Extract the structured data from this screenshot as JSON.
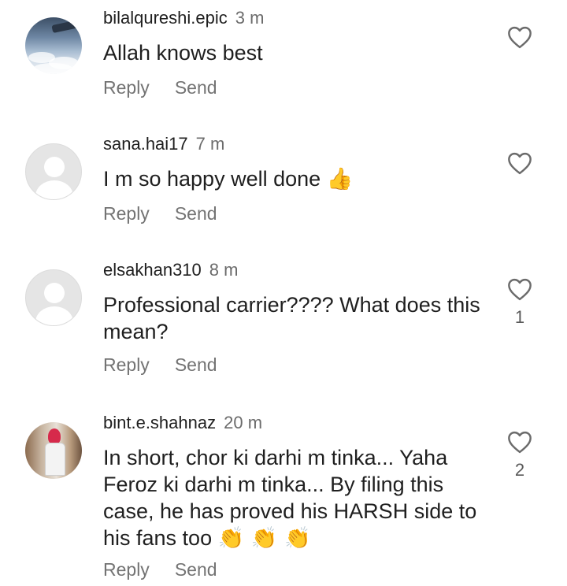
{
  "comments": [
    {
      "username": "bilalqureshi.epic",
      "time": "3 m",
      "text": "Allah knows best",
      "emoji": "",
      "reply_label": "Reply",
      "send_label": "Send",
      "likes": ""
    },
    {
      "username": "sana.hai17",
      "time": "7 m",
      "text": "I m so happy well done",
      "emoji": "👍",
      "reply_label": "Reply",
      "send_label": "Send",
      "likes": ""
    },
    {
      "username": "elsakhan310",
      "time": "8 m",
      "text": "Professional carrier???? What does this mean?",
      "emoji": "",
      "reply_label": "Reply",
      "send_label": "Send",
      "likes": "1"
    },
    {
      "username": "bint.e.shahnaz",
      "time": "20 m",
      "text": "In short, chor ki darhi m tinka... Yaha Feroz ki darhi m tinka... By filing this case, he has proved his HARSH side to his fans too",
      "emoji": "👏 👏 👏",
      "reply_label": "Reply",
      "send_label": "Send",
      "likes": "2"
    }
  ],
  "icons": {
    "like": "heart-outline-icon"
  },
  "colors": {
    "text": "#1f1f1f",
    "secondary": "#737373",
    "background": "#ffffff"
  }
}
